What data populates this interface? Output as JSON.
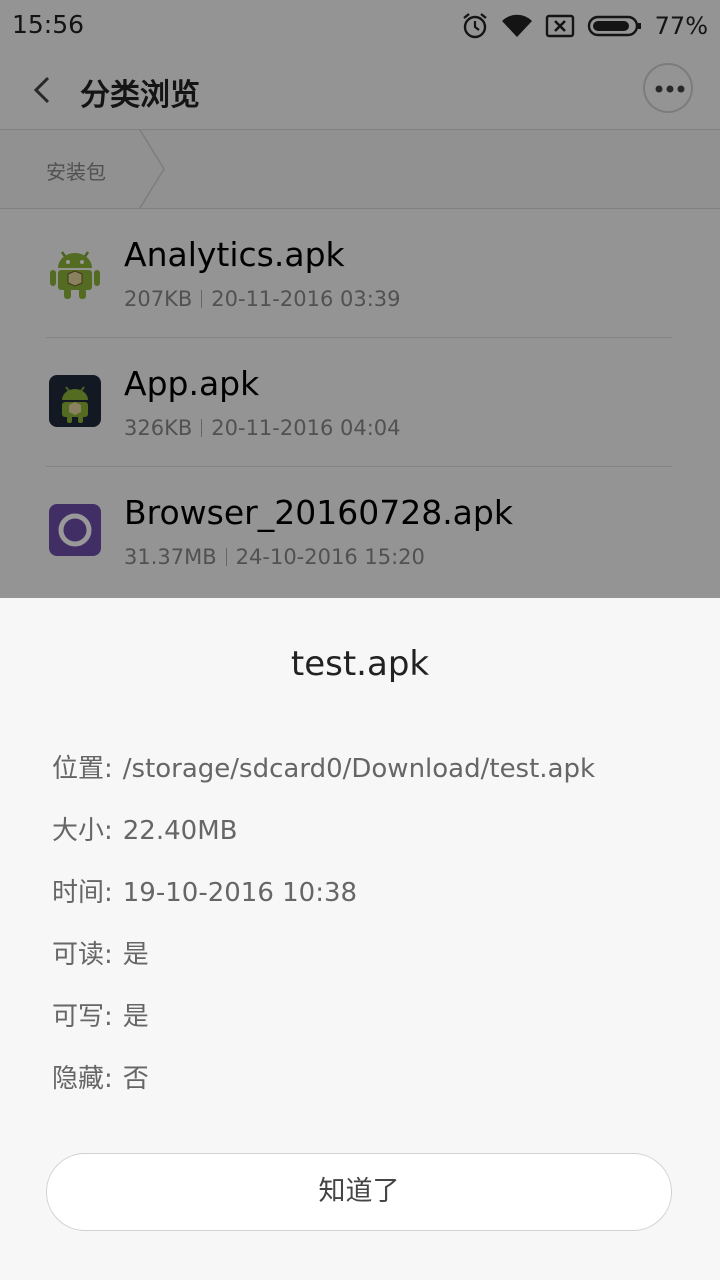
{
  "status_bar": {
    "time": "15:56",
    "battery": "77%"
  },
  "app_bar": {
    "title": "分类浏览"
  },
  "breadcrumb": {
    "current": "安装包"
  },
  "files": [
    {
      "name": "Analytics.apk",
      "size": "207KB",
      "date": "20-11-2016 03:39",
      "icon": "android-robot-icon"
    },
    {
      "name": "App.apk",
      "size": "326KB",
      "date": "20-11-2016 04:04",
      "icon": "android-dark-app-icon"
    },
    {
      "name": "Browser_20160728.apk",
      "size": "31.37MB",
      "date": "24-10-2016 15:20",
      "icon": "browser-app-icon"
    }
  ],
  "dialog": {
    "title": "test.apk",
    "properties": [
      {
        "label": "位置:",
        "value": "/storage/sdcard0/Download/test.apk"
      },
      {
        "label": "大小:",
        "value": "22.40MB"
      },
      {
        "label": "时间:",
        "value": "19-10-2016 10:38"
      },
      {
        "label": "可读:",
        "value": "是"
      },
      {
        "label": "可写:",
        "value": "是"
      },
      {
        "label": "隐藏:",
        "value": "否"
      }
    ],
    "confirm_label": "知道了"
  },
  "colors": {
    "overlay": "#000000",
    "background": "#f7f7f7",
    "android_green": "#8cb33a",
    "browser_purple": "#6b4ea8"
  }
}
